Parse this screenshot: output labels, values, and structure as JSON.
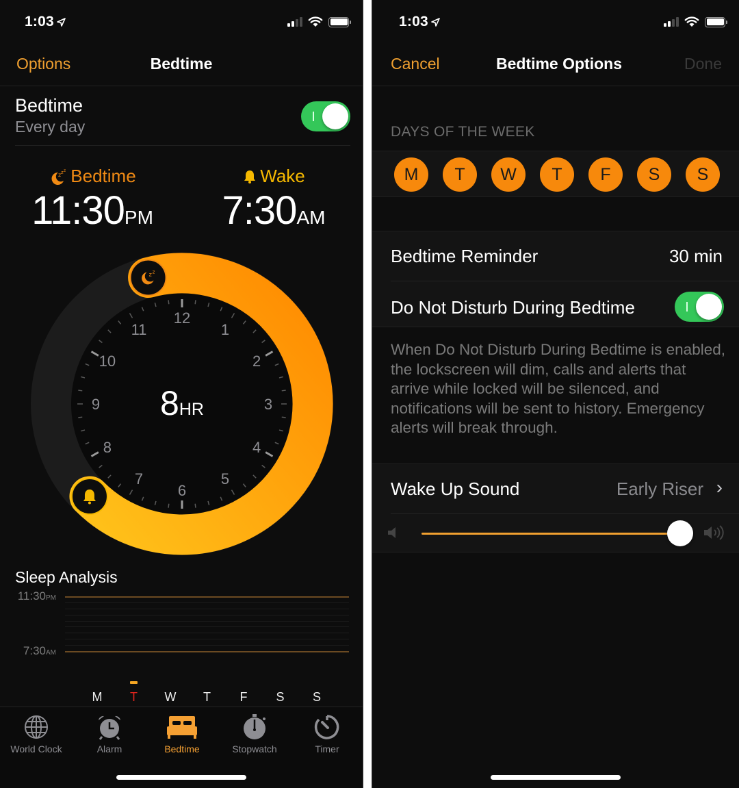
{
  "left_screen": {
    "status_bar": {
      "time": "1:03",
      "signal_bars_on": 2,
      "signal_bars_total": 4,
      "battery_level": 1.0
    },
    "nav": {
      "left_button": "Options",
      "title": "Bedtime"
    },
    "bedtime_toggle": {
      "title": "Bedtime",
      "subtitle": "Every day",
      "on": true
    },
    "bedtime": {
      "label": "Bedtime",
      "time": "11:30",
      "ampm": "PM",
      "icon": "moon-zzz-icon"
    },
    "wake": {
      "label": "Wake",
      "time": "7:30",
      "ampm": "AM",
      "icon": "bell-icon"
    },
    "clock": {
      "duration_value": "8",
      "duration_unit": "HR",
      "hour_labels": [
        "12",
        "1",
        "2",
        "3",
        "4",
        "5",
        "6",
        "7",
        "8",
        "9",
        "10",
        "11"
      ],
      "bedtime_hour": 23.5,
      "wake_hour": 7.5,
      "colors": {
        "start": "#ff8a00",
        "end": "#ffc21a",
        "track": "#1c1c1c",
        "face": "#0a0a0a"
      }
    },
    "sleep_analysis": {
      "title": "Sleep Analysis",
      "top_label": {
        "time": "11:30",
        "ampm": "PM"
      },
      "bottom_label": {
        "time": "7:30",
        "ampm": "AM"
      },
      "days": [
        "M",
        "T",
        "W",
        "T",
        "F",
        "S",
        "S"
      ],
      "today_index": 1
    },
    "tab_bar": {
      "tabs": [
        {
          "label": "World Clock",
          "icon": "globe-icon",
          "active": false
        },
        {
          "label": "Alarm",
          "icon": "alarm-clock-icon",
          "active": false
        },
        {
          "label": "Bedtime",
          "icon": "bed-icon",
          "active": true
        },
        {
          "label": "Stopwatch",
          "icon": "stopwatch-icon",
          "active": false
        },
        {
          "label": "Timer",
          "icon": "timer-icon",
          "active": false
        }
      ]
    }
  },
  "right_screen": {
    "status_bar": {
      "time": "1:03",
      "signal_bars_on": 2,
      "signal_bars_total": 4,
      "battery_level": 1.0
    },
    "nav": {
      "left_button": "Cancel",
      "title": "Bedtime Options",
      "right_button": "Done",
      "right_enabled": false
    },
    "days_header": "DAYS OF THE WEEK",
    "days": [
      {
        "label": "M",
        "selected": true
      },
      {
        "label": "T",
        "selected": true
      },
      {
        "label": "W",
        "selected": true
      },
      {
        "label": "T",
        "selected": true
      },
      {
        "label": "F",
        "selected": true
      },
      {
        "label": "S",
        "selected": true
      },
      {
        "label": "S",
        "selected": true
      }
    ],
    "bedtime_reminder": {
      "label": "Bedtime Reminder",
      "value": "30 min"
    },
    "dnd": {
      "label": "Do Not Disturb During Bedtime",
      "on": true
    },
    "dnd_footer": "When Do Not Disturb During Bedtime is enabled, the lockscreen will dim, calls and alerts that arrive while locked will be silenced, and notifications will be sent to history. Emergency alerts will break through.",
    "wake_sound": {
      "label": "Wake Up Sound",
      "value": "Early Riser"
    },
    "volume": {
      "level": 1.0,
      "accent": "#f0a030"
    }
  }
}
